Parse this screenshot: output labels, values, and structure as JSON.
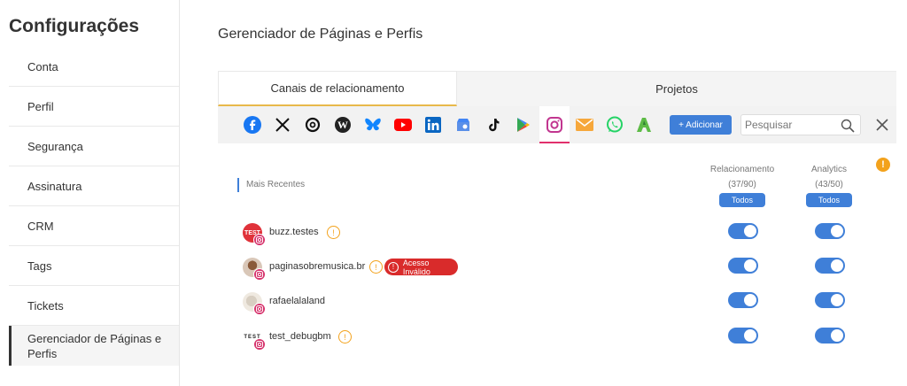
{
  "sidebar": {
    "title": "Configurações",
    "items": [
      {
        "label": "Conta"
      },
      {
        "label": "Perfil"
      },
      {
        "label": "Segurança"
      },
      {
        "label": "Assinatura"
      },
      {
        "label": "CRM"
      },
      {
        "label": "Tags"
      },
      {
        "label": "Tickets"
      },
      {
        "label": "Gerenciador de Páginas e Perfis",
        "active": true
      }
    ]
  },
  "main": {
    "title": "Gerenciador de Páginas e Perfis",
    "tabs": [
      {
        "label": "Canais de relacionamento",
        "active": true
      },
      {
        "label": "Projetos"
      }
    ],
    "toolbar": {
      "networks": [
        "facebook-icon",
        "x-icon",
        "threads-icon",
        "wordpress-icon",
        "bluesky-icon",
        "youtube-icon",
        "linkedin-icon",
        "google-business-icon",
        "tiktok-icon",
        "google-play-icon",
        "instagram-icon",
        "email-icon",
        "whatsapp-icon",
        "reclame-aqui-icon"
      ],
      "selected_network": "instagram-icon",
      "add_label": "+ Adicionar",
      "search_placeholder": "Pesquisar"
    },
    "table": {
      "recent_label": "Mais Recentes",
      "columns": [
        {
          "title": "Relacionamento",
          "count": "(37/90)",
          "filter": "Todos"
        },
        {
          "title": "Analytics",
          "count": "(43/50)",
          "filter": "Todos"
        }
      ],
      "rows": [
        {
          "name": "buzz.testes",
          "warning": true,
          "invalid": "",
          "avatar_text": "TEST"
        },
        {
          "name": "paginasobremusica.br",
          "warning": true,
          "invalid": "Acesso Inválido",
          "avatar_text": ""
        },
        {
          "name": "rafaelalaland",
          "warning": false,
          "invalid": "",
          "avatar_text": ""
        },
        {
          "name": "test_debugbm",
          "warning": true,
          "invalid": "",
          "avatar_text": "TEST"
        }
      ]
    }
  },
  "colors": {
    "accent": "#3f7fd8",
    "warning": "#f3a21c",
    "error": "#d92b2b",
    "instagram": "#d6336c"
  }
}
